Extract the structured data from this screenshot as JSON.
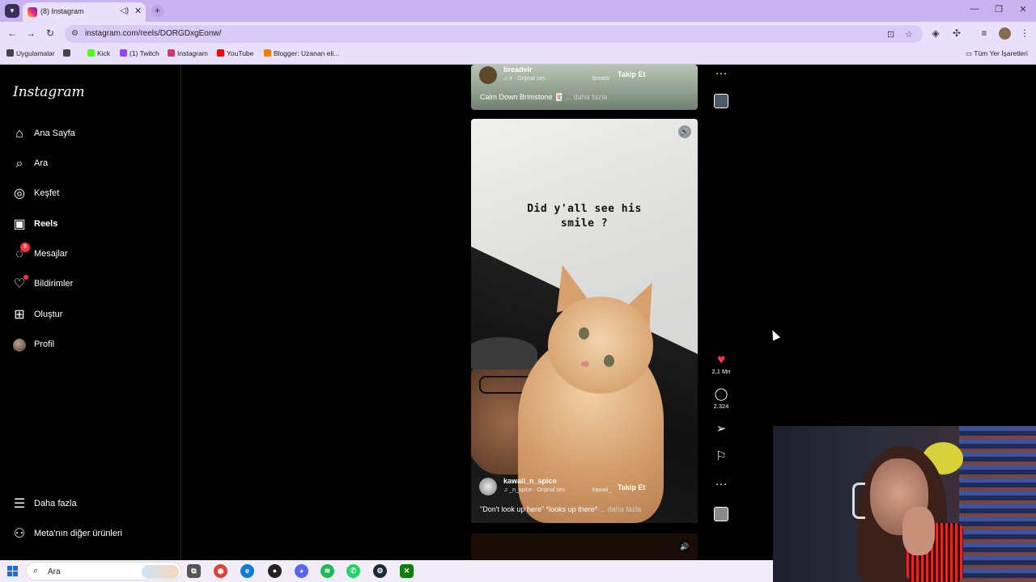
{
  "browser": {
    "tab_title": "(8) Instagram",
    "tab_audio_icon": "speaker-icon",
    "tab_close": "✕",
    "new_tab": "+",
    "url": "instagram.com/reels/DORGDxgEonw/",
    "window_controls": [
      "—",
      "❐",
      "✕"
    ],
    "bookmarks": [
      {
        "label": "Uygulamalar",
        "icon": "apps-grid-icon",
        "color": "#444444"
      },
      {
        "label": "",
        "icon": "grid-icon",
        "color": "#444444"
      },
      {
        "label": "Kick",
        "icon": "kick-icon",
        "color": "#53fc18"
      },
      {
        "label": "(1) Twitch",
        "icon": "twitch-icon",
        "color": "#9146ff"
      },
      {
        "label": "Instagram",
        "icon": "instagram-icon",
        "color": "#e1306c"
      },
      {
        "label": "YouTube",
        "icon": "youtube-icon",
        "color": "#ff0000"
      },
      {
        "label": "Blogger: Uzanan eli...",
        "icon": "blogger-icon",
        "color": "#f57d00"
      }
    ],
    "all_bookmarks": "Tüm Yer İşaretleri"
  },
  "sidebar": {
    "logo": "Instagram",
    "items": [
      {
        "label": "Ana Sayfa",
        "icon": "home-icon",
        "glyph": "⌂"
      },
      {
        "label": "Ara",
        "icon": "search-icon",
        "glyph": "⌕"
      },
      {
        "label": "Keşfet",
        "icon": "compass-icon",
        "glyph": "◎"
      },
      {
        "label": "Reels",
        "icon": "reels-icon",
        "glyph": "▣"
      },
      {
        "label": "Mesajlar",
        "icon": "messenger-icon",
        "glyph": "◌",
        "badge": "8"
      },
      {
        "label": "Bildirimler",
        "icon": "heart-icon",
        "glyph": "♡"
      },
      {
        "label": "Oluştur",
        "icon": "plus-square-icon",
        "glyph": "⊞"
      },
      {
        "label": "Profil",
        "icon": "avatar",
        "glyph": ""
      }
    ],
    "bottom": [
      {
        "label": "Daha fazla",
        "icon": "menu-icon",
        "glyph": "☰"
      },
      {
        "label": "Meta'nın diğer ürünleri",
        "icon": "meta-apps-icon",
        "glyph": "⚇"
      }
    ]
  },
  "reels": {
    "top": {
      "username": "breadvlr",
      "audio": "lr · Orijinal ses",
      "tag": "breadv",
      "follow": "Takip Et",
      "caption": "Calm Down Brimstone 🃏",
      "more": "... daha fazla"
    },
    "current": {
      "overlay_line1": "Did y'all see his",
      "overlay_line2": "smile ?",
      "username": "kawaii_n_spice",
      "audio": "_n_spice · Orijinal ses",
      "tag": "kawaii_",
      "follow": "Takip Et",
      "caption": "\"Don't look up here\" *looks up there*",
      "more": "... daha fazla",
      "likes": "2,1 Mn",
      "comments": "2.324"
    }
  },
  "actions": {
    "more": "···",
    "like": "♥",
    "comment": "◯",
    "share": "➢",
    "save": "⚐",
    "sound": "🔊"
  },
  "taskbar": {
    "search_label": "Ara",
    "apps": [
      {
        "icon": "task-view-icon",
        "glyph": "⧉",
        "color": "#555555"
      },
      {
        "icon": "chrome-icon",
        "glyph": "◉",
        "color": "#db4437"
      },
      {
        "icon": "edge-icon",
        "glyph": "e",
        "color": "#0f7cd8"
      },
      {
        "icon": "obs-icon",
        "glyph": "●",
        "color": "#222222"
      },
      {
        "icon": "discord-icon",
        "glyph": "◕",
        "color": "#5865f2"
      },
      {
        "icon": "spotify-icon",
        "glyph": "≋",
        "color": "#1db954"
      },
      {
        "icon": "whatsapp-icon",
        "glyph": "✆",
        "color": "#25d366"
      },
      {
        "icon": "steam-icon",
        "glyph": "⚙",
        "color": "#1b2838"
      },
      {
        "icon": "xbox-icon",
        "glyph": "✕",
        "color": "#107c10"
      }
    ]
  }
}
